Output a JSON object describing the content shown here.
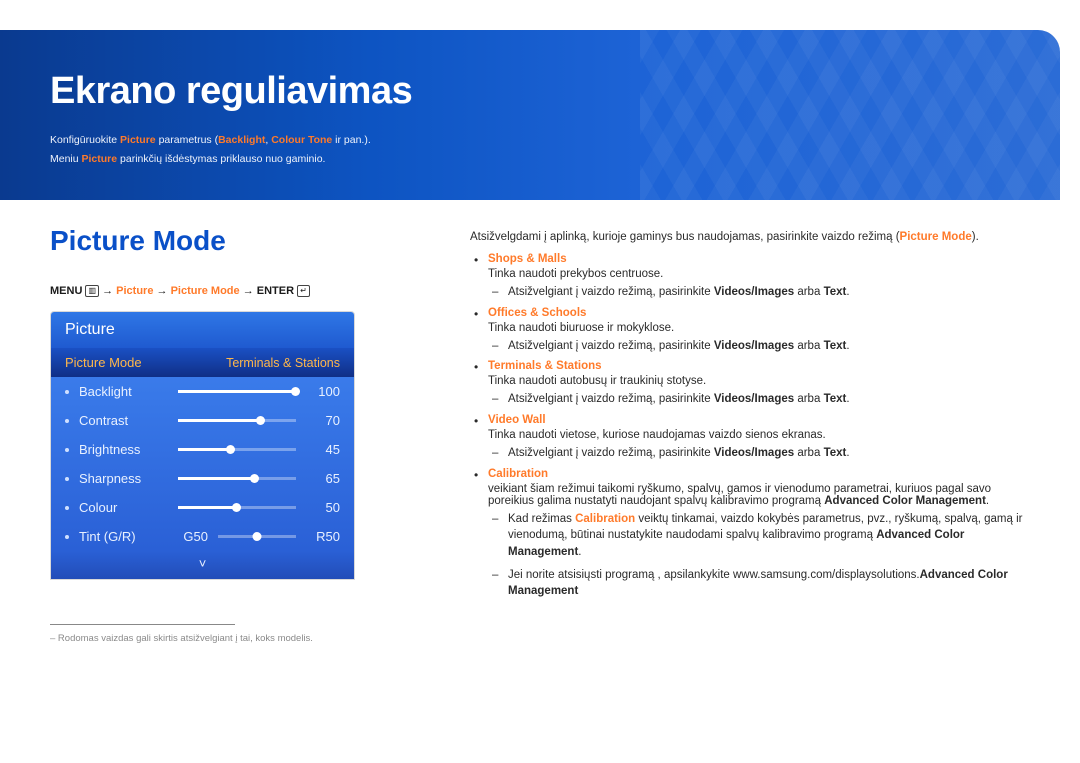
{
  "header": {
    "title": "Ekrano reguliavimas",
    "line1_pre": "Konfigūruokite ",
    "line1_hl1": "Picture",
    "line1_mid": " parametrus (",
    "line1_hl2": "Backlight",
    "line1_sep": ", ",
    "line1_hl3": "Colour Tone",
    "line1_post": " ir pan.).",
    "line2_pre": "Meniu ",
    "line2_hl": "Picture",
    "line2_post": " parinkčių išdėstymas priklauso nuo gaminio."
  },
  "section_title": "Picture Mode",
  "breadcrumb": {
    "menu": "MENU",
    "menu_icon": "▥",
    "arrow": " → ",
    "p1": "Picture",
    "p2": "Picture Mode",
    "enter": "ENTER",
    "enter_icon": "↵"
  },
  "osd": {
    "title": "Picture",
    "selected_left": "Picture Mode",
    "selected_right": "Terminals & Stations",
    "items": [
      {
        "label": "Backlight",
        "value": "100",
        "pct": 100
      },
      {
        "label": "Contrast",
        "value": "70",
        "pct": 70
      },
      {
        "label": "Brightness",
        "value": "45",
        "pct": 45
      },
      {
        "label": "Sharpness",
        "value": "65",
        "pct": 65
      },
      {
        "label": "Colour",
        "value": "50",
        "pct": 50
      }
    ],
    "tint": {
      "label": "Tint (G/R)",
      "g": "G50",
      "r": "R50"
    },
    "chevron": "˅"
  },
  "footnote": "– Rodomas vaizdas gali skirtis atsižvelgiant į tai, koks modelis.",
  "intro_pre": "Atsižvelgdami į aplinką, kurioje gaminys bus naudojamas, pasirinkite vaizdo režimą (",
  "intro_pm": "Picture Mode",
  "intro_post": ").",
  "modes": [
    {
      "name": "Shops & Malls",
      "desc": "Tinka naudoti prekybos centruose.",
      "sub": [
        {
          "pre": "Atsižvelgiant į vaizdo režimą, pasirinkite ",
          "b1": "Videos/Images",
          "mid": " arba ",
          "b2": "Text",
          "post": "."
        }
      ]
    },
    {
      "name": "Offices & Schools",
      "desc": "Tinka naudoti biuruose ir mokyklose.",
      "sub": [
        {
          "pre": "Atsižvelgiant į vaizdo režimą, pasirinkite ",
          "b1": "Videos/Images",
          "mid": " arba ",
          "b2": "Text",
          "post": "."
        }
      ]
    },
    {
      "name": "Terminals & Stations",
      "desc": "Tinka naudoti autobusų ir traukinių stotyse.",
      "sub": [
        {
          "pre": "Atsižvelgiant į vaizdo režimą, pasirinkite ",
          "b1": "Videos/Images",
          "mid": " arba ",
          "b2": "Text",
          "post": "."
        }
      ]
    },
    {
      "name": "Video Wall",
      "desc": "Tinka naudoti vietose, kuriose naudojamas vaizdo sienos ekranas.",
      "sub": [
        {
          "pre": "Atsižvelgiant į vaizdo režimą, pasirinkite ",
          "b1": "Videos/Images",
          "mid": " arba ",
          "b2": "Text",
          "post": "."
        }
      ]
    },
    {
      "name": "Calibration",
      "desc_pre": "veikiant šiam režimui taikomi ryškumo, spalvų, gamos ir vienodumo parametrai, kuriuos pagal savo poreikius galima nustatyti naudojant spalvų kalibravimo programą ",
      "desc_b": "Advanced Color Management",
      "desc_post": ".",
      "sub": [
        {
          "pre": "Kad režimas ",
          "ob1": "Calibration",
          "mid1": " veiktų tinkamai, vaizdo kokybės parametrus, pvz., ryškumą, spalvą, gamą ir vienodumą, būtinai nustatykite naudodami spalvų kalibravimo programą ",
          "b1": "Advanced Color Management",
          "post": "."
        },
        {
          "pre": "Jei norite atsisiųsti programą ",
          "b1": "Advanced Color Management",
          "mid1": ", apsilankykite www.samsung.com/displaysolutions.",
          "post": ""
        }
      ]
    }
  ]
}
